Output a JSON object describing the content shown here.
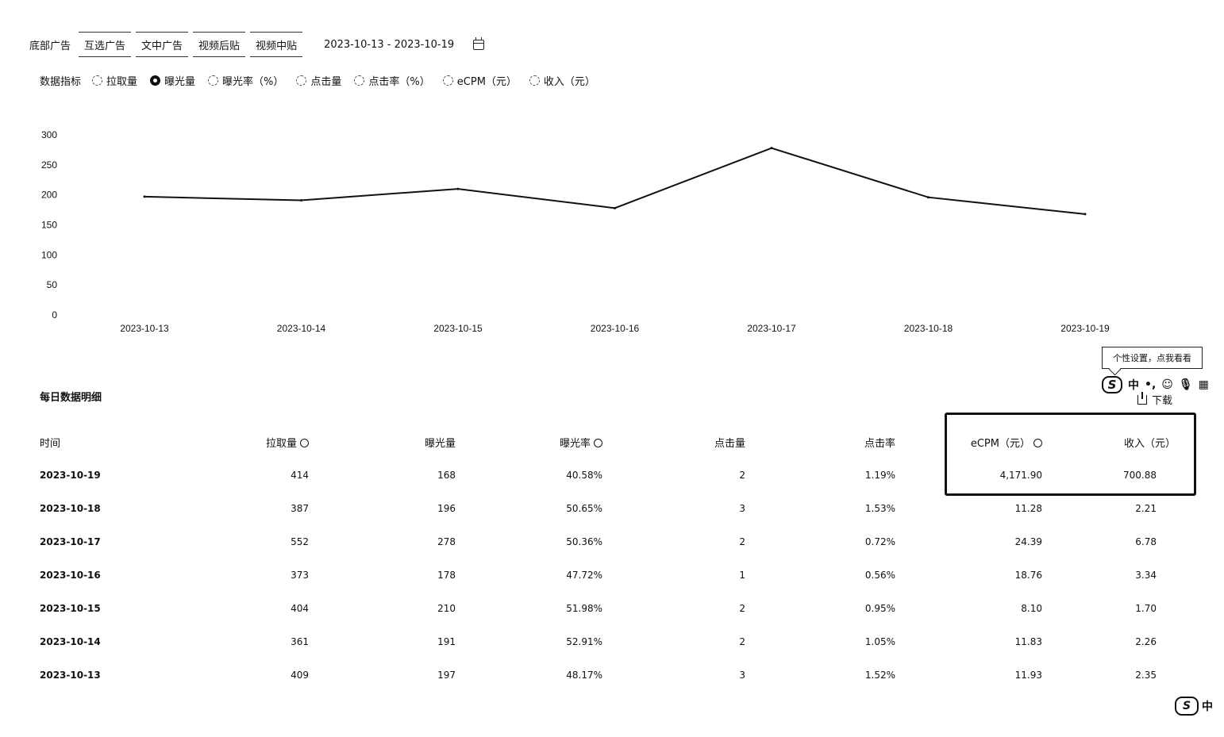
{
  "tabs": [
    {
      "label": "底部广告"
    },
    {
      "label": "互选广告"
    },
    {
      "label": "文中广告"
    },
    {
      "label": "视频后贴"
    },
    {
      "label": "视频中贴"
    }
  ],
  "date_range": "2023-10-13 - 2023-10-19",
  "metrics": {
    "label": "数据指标",
    "options": [
      {
        "label": "拉取量",
        "selected": false
      },
      {
        "label": "曝光量",
        "selected": true
      },
      {
        "label": "曝光率（%）",
        "selected": false
      },
      {
        "label": "点击量",
        "selected": false
      },
      {
        "label": "点击率（%）",
        "selected": false
      },
      {
        "label": "eCPM（元）",
        "selected": false
      },
      {
        "label": "收入（元）",
        "selected": false
      }
    ]
  },
  "chart_data": {
    "type": "line",
    "categories": [
      "2023-10-13",
      "2023-10-14",
      "2023-10-15",
      "2023-10-16",
      "2023-10-17",
      "2023-10-18",
      "2023-10-19"
    ],
    "values": [
      197,
      191,
      210,
      178,
      278,
      196,
      168
    ],
    "yticks": [
      "0",
      "50",
      "100",
      "150",
      "200",
      "250",
      "300"
    ],
    "ylim": [
      0,
      300
    ],
    "grid": false
  },
  "tooltip": "个性设置，点我看看",
  "ime": {
    "lang": "中"
  },
  "section_title": "每日数据明细",
  "download_label": "下载",
  "table": {
    "columns": [
      "时间",
      "拉取量",
      "曝光量",
      "曝光率",
      "点击量",
      "点击率",
      "eCPM（元）",
      "收入（元）"
    ],
    "rows": [
      [
        "2023-10-19",
        "414",
        "168",
        "40.58%",
        "2",
        "1.19%",
        "4,171.90",
        "700.88"
      ],
      [
        "2023-10-18",
        "387",
        "196",
        "50.65%",
        "3",
        "1.53%",
        "11.28",
        "2.21"
      ],
      [
        "2023-10-17",
        "552",
        "278",
        "50.36%",
        "2",
        "0.72%",
        "24.39",
        "6.78"
      ],
      [
        "2023-10-16",
        "373",
        "178",
        "47.72%",
        "1",
        "0.56%",
        "18.76",
        "3.34"
      ],
      [
        "2023-10-15",
        "404",
        "210",
        "51.98%",
        "2",
        "0.95%",
        "8.10",
        "1.70"
      ],
      [
        "2023-10-14",
        "361",
        "191",
        "52.91%",
        "2",
        "1.05%",
        "11.83",
        "2.26"
      ],
      [
        "2023-10-13",
        "409",
        "197",
        "48.17%",
        "3",
        "1.52%",
        "11.93",
        "2.35"
      ]
    ]
  }
}
